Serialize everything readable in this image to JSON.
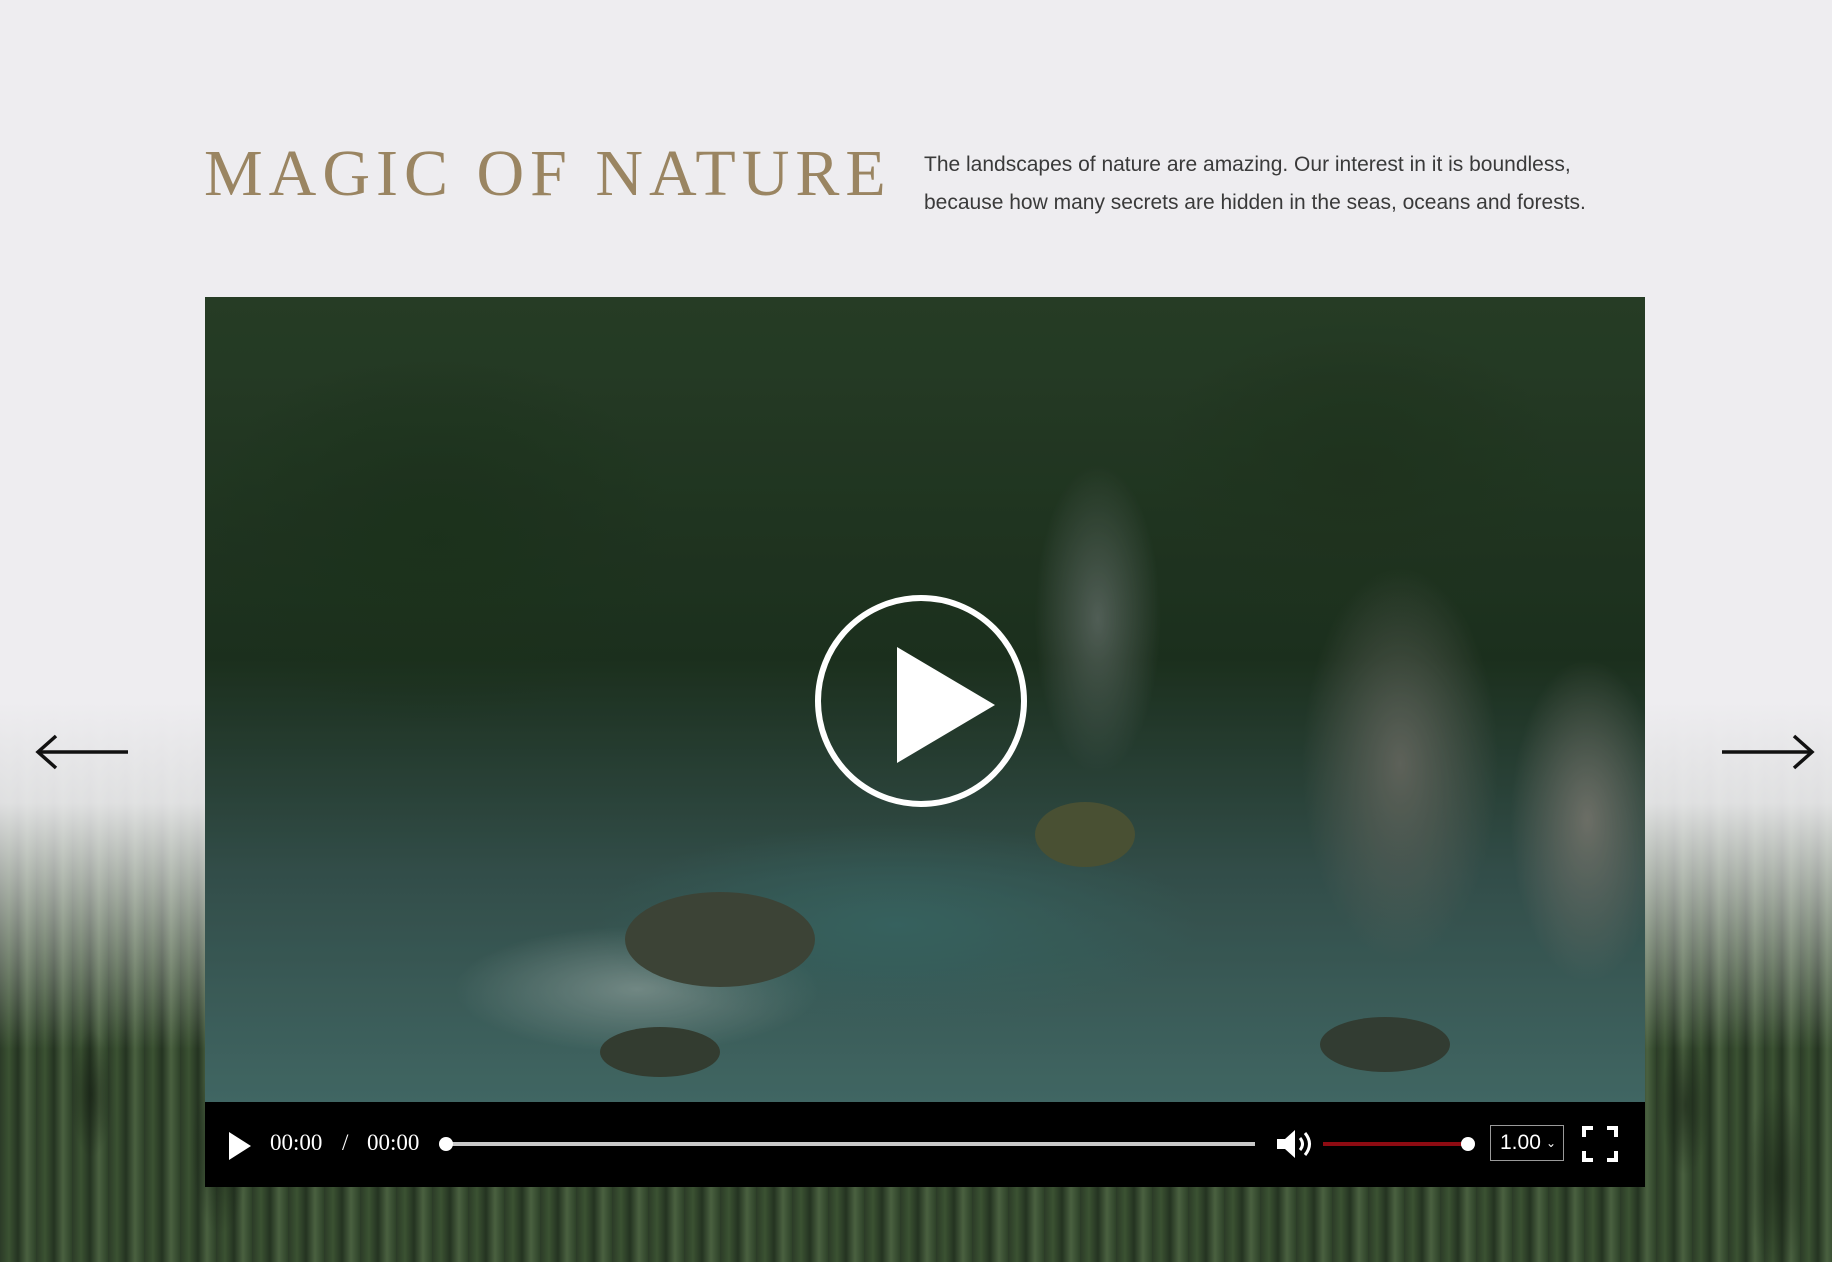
{
  "section": {
    "title": "MAGIC OF NATURE",
    "description": "The landscapes of nature are amazing. Our interest in it is boundless, because how many secrets are hidden in the seas, oceans and forests."
  },
  "player": {
    "current_time": "00:00",
    "separator": "/",
    "duration": "00:00",
    "playback_rate": "1.00",
    "progress": 0,
    "volume": 1.0
  },
  "icons": {
    "big_play": "play-circle-icon",
    "play": "play-icon",
    "volume": "speaker-icon",
    "fullscreen": "fullscreen-icon",
    "prev": "arrow-left-icon",
    "next": "arrow-right-icon"
  },
  "colors": {
    "title": "#9a8562",
    "volume_fill": "#8e0b12",
    "background": "#eeedf0"
  }
}
